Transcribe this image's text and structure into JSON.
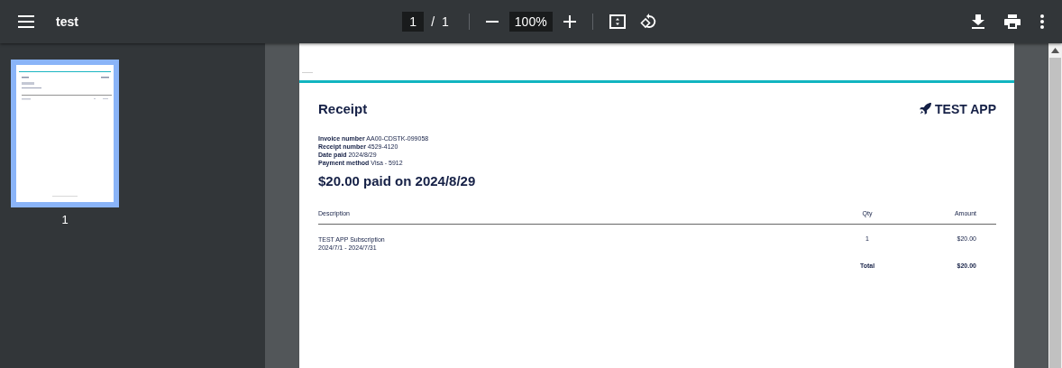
{
  "toolbar": {
    "title": "test",
    "page_number": "1",
    "page_separator": "/",
    "page_count": "1",
    "zoom": "100%"
  },
  "sidebar": {
    "thumbnails": [
      {
        "label": "1",
        "selected": true
      }
    ]
  },
  "document": {
    "title": "Receipt",
    "brand": "TEST APP",
    "details": [
      "**Invoice number** AA00-CDSTK-099058",
      "**Receipt number** 4529-4120",
      "**Date paid** 2024/8/29",
      "**Payment method** Visa - 5912"
    ],
    "headline": "$20.00 paid on 2024/8/29",
    "table": {
      "columns": [
        "Description",
        "Qty",
        "Amount"
      ],
      "rows": [
        {
          "description": [
            "TEST APP Subscription",
            "2024/7/1 - 2024/7/31"
          ],
          "qty": "1",
          "amount": "$20.00"
        }
      ],
      "total_label": "Total",
      "total": "$20.00"
    }
  }
}
